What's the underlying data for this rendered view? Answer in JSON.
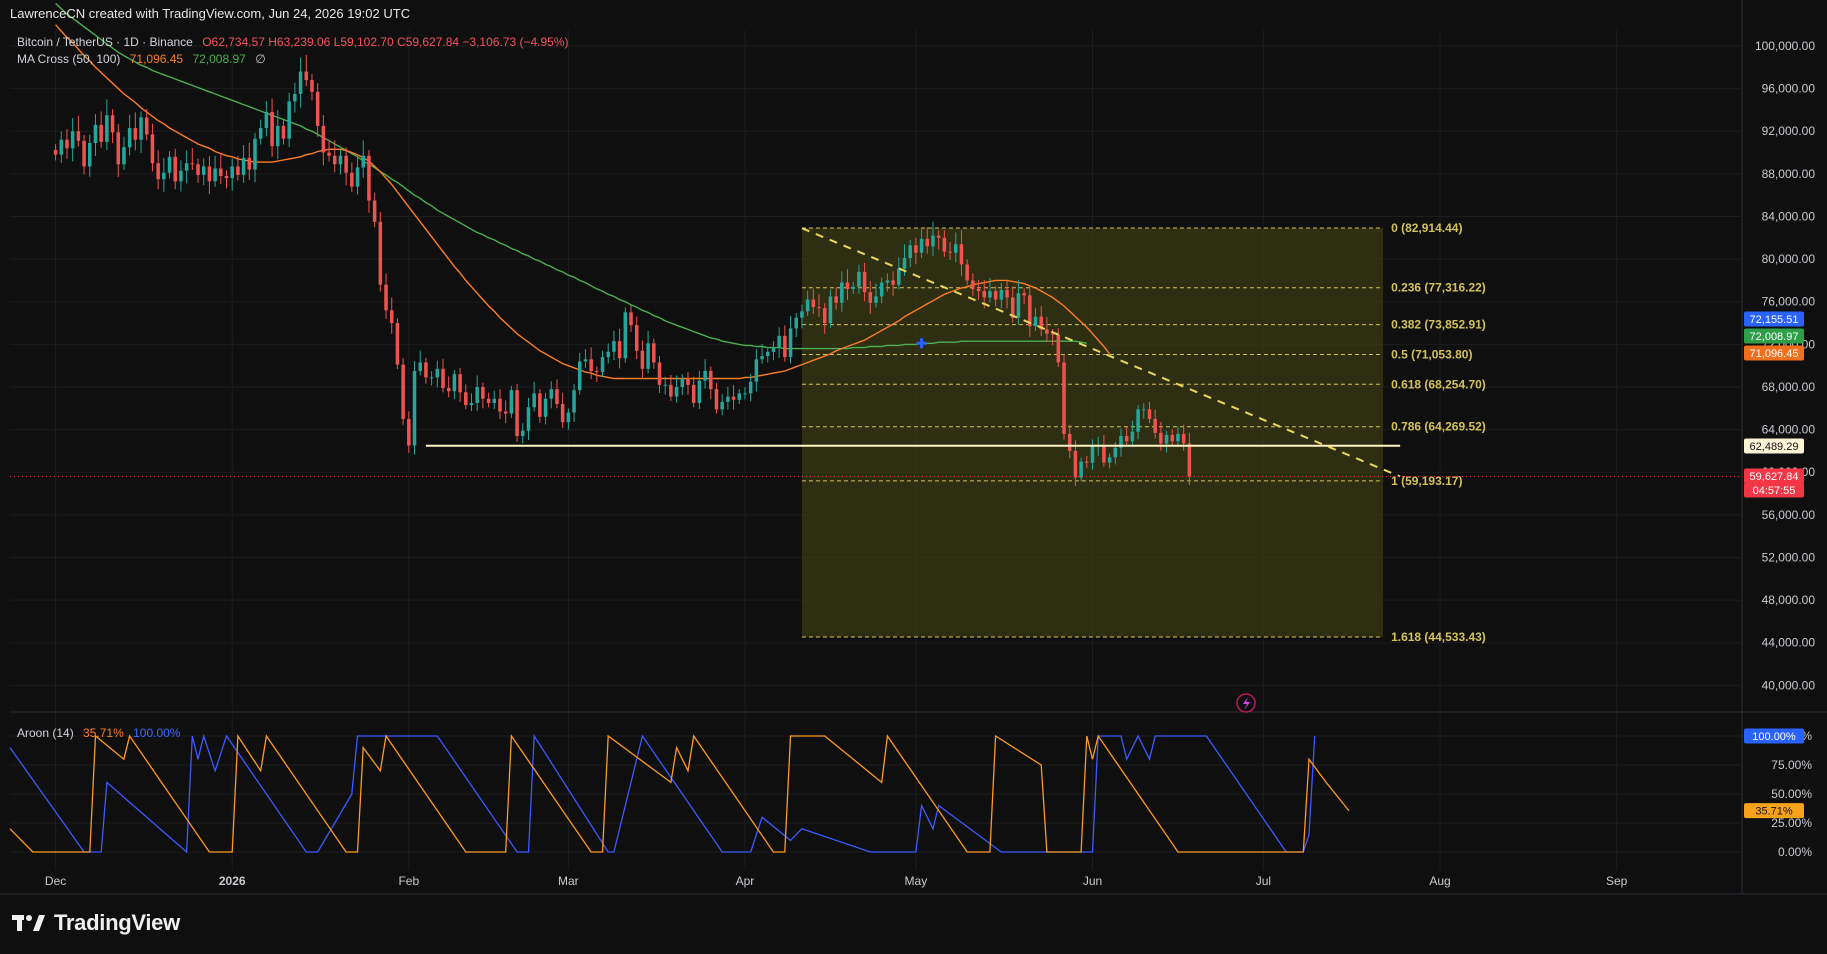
{
  "header": {
    "created_by": "LawrenceCN created with TradingView.com, Jun 24, 2026 19:02 UTC"
  },
  "legend": {
    "symbol": "Bitcoin / TetherUS · 1D · Binance",
    "ohlc": "O62,734.57  H63,239.06  L59,102.70  C59,627.84  −3,106.73 (−4.95%)",
    "ma_name": "MA Cross (50, 100)",
    "ma_fast": "71,096.45",
    "ma_slow": "72,008.97",
    "ma_extra": "∅",
    "aroon_name": "Aroon (14)",
    "aroon_up": "35.71%",
    "aroon_down": "100.00%"
  },
  "footer": {
    "brand": "TradingView"
  },
  "colors": {
    "background": "#0f0f0f",
    "up": "#26a69a",
    "down": "#ef5350",
    "ma_fast": "#ff7d24",
    "ma_slow": "#4caf50",
    "aroon_up": "#ff9a1f",
    "aroon_down": "#3d5afe",
    "fib": "#d4c35a",
    "support": "#fff3c4"
  },
  "chart_data": {
    "type": "candlestick",
    "price_axis": {
      "ylim": [
        37500,
        101500
      ],
      "ticks": [
        "100,000.00",
        "96,000.00",
        "92,000.00",
        "88,000.00",
        "84,000.00",
        "80,000.00",
        "76,000.00",
        "72,000.00",
        "68,000.00",
        "64,000.00",
        "60,000.00",
        "56,000.00",
        "52,000.00",
        "48,000.00",
        "44,000.00",
        "40,000.00"
      ],
      "tick_values": [
        100000,
        96000,
        92000,
        88000,
        84000,
        80000,
        76000,
        72000,
        68000,
        64000,
        60000,
        56000,
        52000,
        48000,
        44000,
        40000
      ]
    },
    "time_axis": {
      "labels": [
        "Dec",
        "2026",
        "Feb",
        "Mar",
        "Apr",
        "May",
        "Jun",
        "Jul",
        "Aug",
        "Sep"
      ],
      "label_days": [
        0,
        31,
        62,
        90,
        121,
        151,
        182,
        212,
        243,
        274
      ],
      "day_range": [
        -8,
        296
      ]
    },
    "price_labels": [
      {
        "text": "72,155.51",
        "value": 72155.51,
        "color": "#2962ff"
      },
      {
        "text": "72,008.97",
        "value": 72008.97,
        "color": "#2e9e48"
      },
      {
        "text": "71,096.45",
        "value": 71096.45,
        "color": "#f0701d"
      },
      {
        "text": "62,489.29",
        "value": 62489.29,
        "color": "#fff3d6"
      },
      {
        "text": "59,627.84",
        "value": 59627.84,
        "color": "#f23645"
      },
      {
        "text": "04:57:55",
        "value": 59627.84,
        "color": "#f23645"
      }
    ],
    "fibonacci": {
      "start_day": 131,
      "end_day": 233,
      "levels": [
        {
          "label": "0 (82,914.44)",
          "value": 82914.44
        },
        {
          "label": "0.236 (77,316.22)",
          "value": 77316.22
        },
        {
          "label": "0.382 (73,852.91)",
          "value": 73852.91
        },
        {
          "label": "0.5 (71,053.80)",
          "value": 71053.8
        },
        {
          "label": "0.618 (68,254.70)",
          "value": 68254.7
        },
        {
          "label": "0.786 (64,269.52)",
          "value": 64269.52
        },
        {
          "label": "1 (59,193.17)",
          "value": 59193.17
        },
        {
          "label": "1.618 (44,533.43)",
          "value": 44533.43
        }
      ]
    },
    "support_line": {
      "value": 62489.29,
      "start_day": 65,
      "end_day": 236
    },
    "trendline": {
      "points": [
        [
          131,
          82900
        ],
        [
          236,
          59600
        ]
      ]
    },
    "close": [
      89800,
      91200,
      90400,
      92000,
      91100,
      88700,
      90900,
      92600,
      91000,
      93500,
      91900,
      88900,
      90500,
      92300,
      91200,
      93300,
      91700,
      89000,
      87500,
      88100,
      89600,
      87300,
      88300,
      89000,
      88900,
      87900,
      88700,
      87300,
      88500,
      87800,
      87600,
      88700,
      87900,
      89500,
      88400,
      91300,
      92300,
      93800,
      90600,
      92500,
      91300,
      94800,
      95500,
      97600,
      96800,
      95700,
      92500,
      90000,
      89700,
      88900,
      89700,
      88100,
      86800,
      88600,
      89700,
      85500,
      83500,
      77600,
      75200,
      74000,
      70100,
      65000,
      62500,
      69500,
      70300,
      68900,
      68900,
      69700,
      67900,
      67600,
      69200,
      67500,
      66300,
      66500,
      68000,
      66900,
      66500,
      66900,
      65700,
      65500,
      67700,
      63400,
      63900,
      66100,
      67400,
      65200,
      66900,
      67800,
      66400,
      64700,
      65600,
      67700,
      70400,
      70600,
      69500,
      69400,
      70800,
      71300,
      72300,
      70700,
      75000,
      73800,
      71400,
      69700,
      72100,
      70300,
      68200,
      68200,
      67100,
      68000,
      68800,
      68200,
      66500,
      68600,
      69500,
      67800,
      65900,
      66600,
      67100,
      66800,
      67400,
      67400,
      68500,
      70600,
      70900,
      71300,
      71700,
      72800,
      70800,
      73500,
      74500,
      75100,
      76200,
      75500,
      75400,
      74000,
      76500,
      75900,
      77800,
      77200,
      77400,
      78800,
      76900,
      75900,
      76500,
      77800,
      78000,
      77600,
      79100,
      80100,
      81300,
      80600,
      81900,
      81200,
      82200,
      82000,
      80700,
      80600,
      81400,
      79500,
      78000,
      77200,
      77000,
      76400,
      77000,
      76200,
      77100,
      76400,
      74500,
      76800,
      76600,
      73700,
      74600,
      73400,
      73000,
      72900,
      70300,
      63600,
      62000,
      59500,
      61000,
      60900,
      62400,
      62500,
      60900,
      61400,
      62300,
      63400,
      62900,
      63800,
      65900,
      65900,
      65000,
      63700,
      62700,
      63500,
      62900,
      63600,
      62700,
      59600
    ],
    "ma_fast": [
      102000,
      101400,
      100800,
      100300,
      99700,
      99100,
      98600,
      98000,
      97500,
      97000,
      96500,
      96000,
      95500,
      95100,
      94700,
      94200,
      93800,
      93400,
      93000,
      92700,
      92300,
      92000,
      91700,
      91400,
      91100,
      90800,
      90600,
      90400,
      90100,
      89900,
      89700,
      89600,
      89400,
      89300,
      89200,
      89100,
      89100,
      89100,
      89100,
      89200,
      89300,
      89400,
      89500,
      89600,
      89800,
      89900,
      90100,
      90200,
      90300,
      90300,
      90300,
      90200,
      90000,
      89800,
      89500,
      89200,
      88700,
      88200,
      87600,
      87000,
      86300,
      85600,
      84900,
      84200,
      83500,
      82800,
      82100,
      81400,
      80700,
      80000,
      79300,
      78700,
      78000,
      77400,
      76800,
      76200,
      75600,
      75100,
      74500,
      74000,
      73500,
      73000,
      72600,
      72200,
      71800,
      71400,
      71100,
      70800,
      70500,
      70200,
      70000,
      69800,
      69600,
      69400,
      69300,
      69100,
      69000,
      68900,
      68800,
      68800,
      68800,
      68800,
      68800,
      68800,
      68800,
      68800,
      68800,
      68800,
      68800,
      68800,
      68800,
      68800,
      68800,
      68800,
      68800,
      68800,
      68800,
      68800,
      68800,
      68800,
      68800,
      68900,
      68900,
      69000,
      69100,
      69200,
      69300,
      69400,
      69500,
      69700,
      69900,
      70100,
      70300,
      70500,
      70700,
      70900,
      71100,
      71400,
      71600,
      71800,
      72000,
      72200,
      72400,
      72700,
      73000,
      73300,
      73600,
      73900,
      74200,
      74600,
      74900,
      75200,
      75500,
      75800,
      76100,
      76400,
      76700,
      76900,
      77100,
      77300,
      77400,
      77600,
      77700,
      77800,
      77900,
      78000,
      78000,
      78000,
      77900,
      77800,
      77700,
      77500,
      77300,
      77000,
      76700,
      76400,
      76000,
      75600,
      75100,
      74600,
      74100,
      73600,
      73000,
      72400,
      71800,
      71100
    ],
    "ma_slow": [
      104000,
      103500,
      103000,
      102600,
      102200,
      101800,
      101400,
      101000,
      100600,
      100200,
      99800,
      99400,
      99100,
      98800,
      98500,
      98200,
      98000,
      97700,
      97500,
      97300,
      97100,
      96900,
      96700,
      96500,
      96300,
      96100,
      95900,
      95700,
      95500,
      95300,
      95100,
      94900,
      94700,
      94500,
      94300,
      94100,
      93900,
      93700,
      93500,
      93300,
      93100,
      92900,
      92700,
      92500,
      92200,
      92000,
      91700,
      91400,
      91100,
      90800,
      90500,
      90200,
      89900,
      89600,
      89200,
      88900,
      88600,
      88200,
      87900,
      87500,
      87200,
      86800,
      86400,
      86000,
      85700,
      85300,
      85000,
      84600,
      84300,
      84000,
      83700,
      83400,
      83100,
      82800,
      82500,
      82300,
      82000,
      81800,
      81500,
      81300,
      81000,
      80800,
      80500,
      80300,
      80000,
      79800,
      79500,
      79300,
      79000,
      78800,
      78500,
      78300,
      78000,
      77800,
      77500,
      77200,
      77000,
      76700,
      76500,
      76200,
      76000,
      75700,
      75500,
      75200,
      75000,
      74700,
      74500,
      74200,
      74000,
      73800,
      73600,
      73400,
      73200,
      73000,
      72800,
      72600,
      72500,
      72300,
      72200,
      72100,
      72000,
      71900,
      71900,
      71800,
      71800,
      71700,
      71700,
      71700,
      71600,
      71600,
      71600,
      71600,
      71600,
      71600,
      71600,
      71600,
      71600,
      71600,
      71600,
      71600,
      71700,
      71700,
      71700,
      71800,
      71800,
      71800,
      71900,
      71900,
      71900,
      72000,
      72000,
      72000,
      72100,
      72100,
      72100,
      72200,
      72200,
      72200,
      72200,
      72300,
      72300,
      72300,
      72300,
      72300,
      72300,
      72300,
      72300,
      72300,
      72300,
      72300,
      72300,
      72300,
      72300,
      72300,
      72300,
      72300,
      72300,
      72300,
      72300,
      72300,
      72200,
      72100
    ],
    "aroon": {
      "ylim": [
        0,
        100
      ],
      "ticks": [
        "100.00%",
        "75.00%",
        "50.00%",
        "25.00%",
        "0.00%"
      ],
      "tick_values": [
        100,
        75,
        50,
        25,
        0
      ],
      "current_labels": [
        {
          "text": "100.00%",
          "value": 100,
          "color": "#2962ff"
        },
        {
          "text": "35.71%",
          "value": 35.71,
          "color": "#f7a21b"
        }
      ],
      "up": [
        [
          -8,
          20
        ],
        [
          -4,
          0
        ],
        [
          6,
          0
        ],
        [
          7,
          100
        ],
        [
          12,
          80
        ],
        [
          13,
          100
        ],
        [
          27,
          0
        ],
        [
          31,
          0
        ],
        [
          32,
          100
        ],
        [
          36,
          70
        ],
        [
          37,
          100
        ],
        [
          51,
          0
        ],
        [
          53,
          0
        ],
        [
          54,
          90
        ],
        [
          57,
          70
        ],
        [
          58,
          100
        ],
        [
          72,
          0
        ],
        [
          79,
          0
        ],
        [
          80,
          100
        ],
        [
          94,
          0
        ],
        [
          96,
          0
        ],
        [
          97,
          100
        ],
        [
          108,
          60
        ],
        [
          109,
          90
        ],
        [
          111,
          70
        ],
        [
          112,
          100
        ],
        [
          126,
          0
        ],
        [
          128,
          0
        ],
        [
          129,
          100
        ],
        [
          135,
          100
        ],
        [
          145,
          60
        ],
        [
          146,
          100
        ],
        [
          160,
          0
        ],
        [
          164,
          0
        ],
        [
          165,
          100
        ],
        [
          173,
          75
        ],
        [
          174,
          0
        ],
        [
          180,
          0
        ],
        [
          181,
          100
        ],
        [
          182,
          80
        ],
        [
          183,
          100
        ],
        [
          197,
          0
        ],
        [
          208,
          0
        ],
        [
          219,
          0
        ],
        [
          220,
          80
        ],
        [
          223,
          60
        ],
        [
          227,
          35.71
        ]
      ],
      "down": [
        [
          -8,
          90
        ],
        [
          5,
          0
        ],
        [
          8,
          0
        ],
        [
          9,
          60
        ],
        [
          23,
          0
        ],
        [
          24,
          100
        ],
        [
          25,
          80
        ],
        [
          26,
          100
        ],
        [
          28,
          70
        ],
        [
          30,
          100
        ],
        [
          44,
          0
        ],
        [
          46,
          0
        ],
        [
          52,
          50
        ],
        [
          53,
          100
        ],
        [
          67,
          100
        ],
        [
          81,
          0
        ],
        [
          83,
          0
        ],
        [
          84,
          100
        ],
        [
          97,
          0
        ],
        [
          98,
          0
        ],
        [
          103,
          100
        ],
        [
          117,
          0
        ],
        [
          122,
          0
        ],
        [
          124,
          30
        ],
        [
          129,
          10
        ],
        [
          131,
          20
        ],
        [
          143,
          0
        ],
        [
          151,
          0
        ],
        [
          152,
          40
        ],
        [
          154,
          20
        ],
        [
          155,
          40
        ],
        [
          166,
          0
        ],
        [
          182,
          0
        ],
        [
          183,
          100
        ],
        [
          187,
          100
        ],
        [
          188,
          80
        ],
        [
          190,
          100
        ],
        [
          192,
          80
        ],
        [
          193,
          100
        ],
        [
          202,
          100
        ],
        [
          216,
          0
        ],
        [
          219,
          0
        ],
        [
          220,
          15
        ],
        [
          221,
          100
        ]
      ]
    }
  }
}
